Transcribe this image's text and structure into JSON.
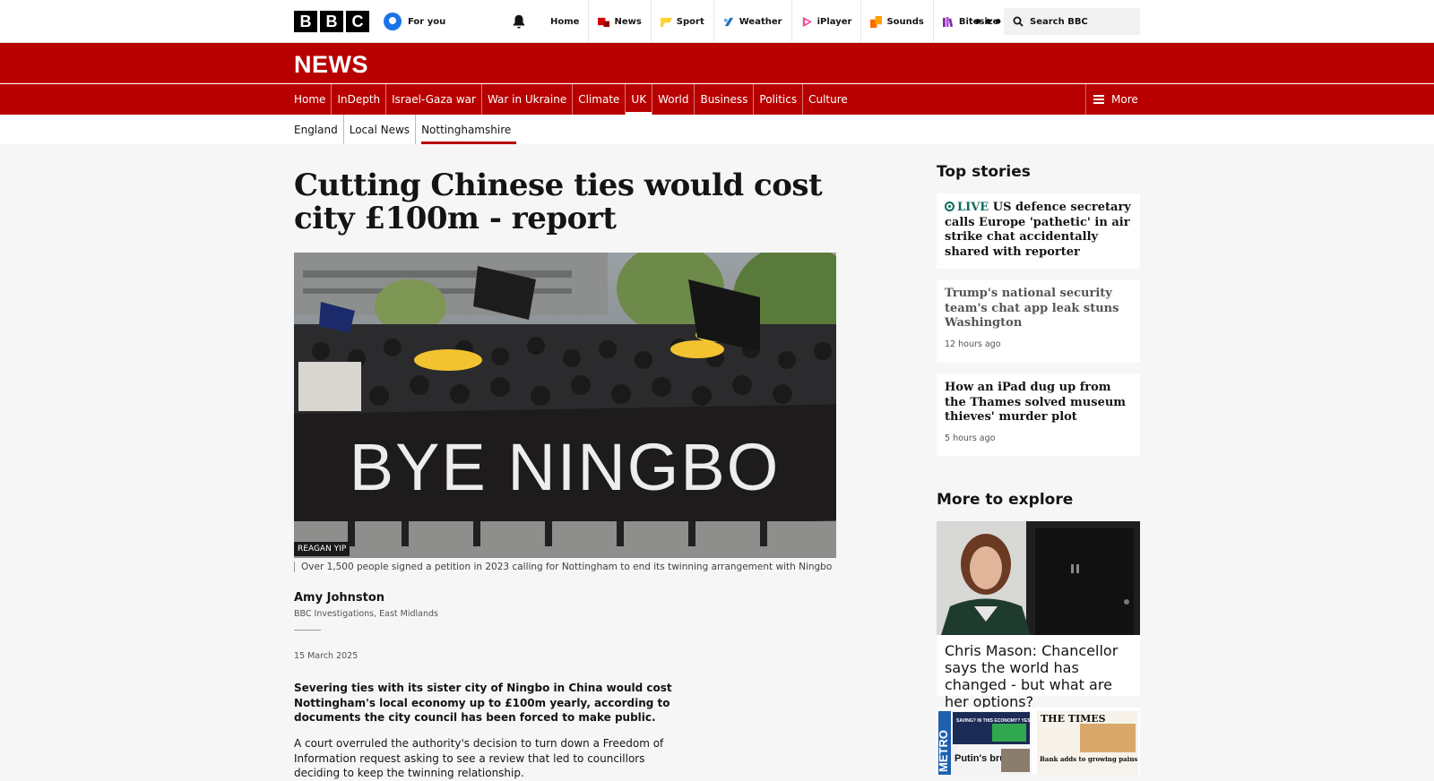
{
  "topbar": {
    "logo_letters": [
      "B",
      "B",
      "C"
    ],
    "for_you": "For you",
    "nav": [
      {
        "label": "Home",
        "color": ""
      },
      {
        "label": "News",
        "color": "#d40000"
      },
      {
        "label": "Sport",
        "color": "#ffd230"
      },
      {
        "label": "Weather",
        "color": "#1f6fb3"
      },
      {
        "label": "iPlayer",
        "color": "#f54997"
      },
      {
        "label": "Sounds",
        "color": "#ff6a00"
      },
      {
        "label": "Bitesize",
        "color": "#8a24b0"
      }
    ],
    "more_glyph": "•••",
    "search_label": "Search BBC"
  },
  "news_title": "NEWS",
  "section_nav": {
    "links": [
      "Home",
      "InDepth",
      "Israel-Gaza war",
      "War in Ukraine",
      "Climate",
      "UK",
      "World",
      "Business",
      "Politics",
      "Culture"
    ],
    "active": "UK",
    "more": "More"
  },
  "sub_nav": {
    "links": [
      "England",
      "Local News",
      "Nottinghamshire"
    ],
    "active": "Nottinghamshire"
  },
  "article": {
    "headline": "Cutting Chinese ties would cost city £100m - report",
    "image_banner": "BYE NINGBO",
    "image_credit": "REAGAN YIP",
    "caption": "Over 1,500 people signed a petition in 2023 calling for Nottingham to end its twinning arrangement with Ningbo",
    "author": "Amy Johnston",
    "author_role": "BBC Investigations, East Midlands",
    "date": "15 March 2025",
    "lead": "Severing ties with its sister city of Ningbo in China would cost Nottingham's local economy up to £100m yearly, according to documents the city council has been forced to make public.",
    "body": "A court overruled the authority's decision to turn down a Freedom of Information request asking to see a review that led to councillors deciding to keep the twinning relationship."
  },
  "top_stories": {
    "heading": "Top stories",
    "items": [
      {
        "live": "LIVE",
        "title": "US defence secretary calls Europe 'pathetic' in air strike chat accidentally shared with reporter"
      },
      {
        "title": "Trump's national security team's chat app leak stuns Washington",
        "time": "12 hours ago"
      },
      {
        "title": "How an iPad dug up from the Thames solved museum thieves' murder plot",
        "time": "5 hours ago"
      }
    ]
  },
  "more_to_explore": {
    "heading": "More to explore",
    "items": [
      {
        "title": "Chris Mason: Chancellor says the world has changed - but what are her options?"
      }
    ],
    "papers": {
      "metro": "METRO",
      "metro_sub": "SAVING? IN THIS ECONOMY? YES.",
      "metro_head": "Putin's brutal",
      "times": "THE TIMES",
      "times_head": "Bank adds to growing pains for"
    }
  },
  "colors": {
    "bbc_red": "#b80000",
    "live_green": "#0d6b5e"
  }
}
